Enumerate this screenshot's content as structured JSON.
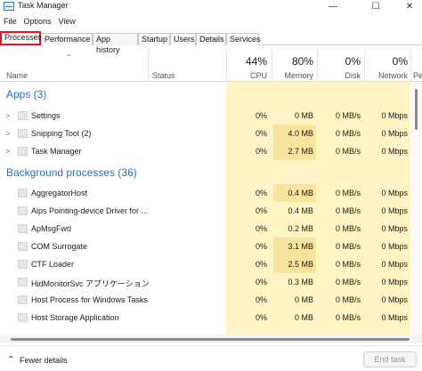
{
  "window": {
    "title": "Task Manager",
    "minimize_glyph": "—",
    "maximize_glyph": "☐",
    "close_glyph": "✕"
  },
  "menu": [
    "File",
    "Options",
    "View"
  ],
  "tabs": [
    "Processes",
    "Performance",
    "App history",
    "Startup",
    "Users",
    "Details",
    "Services"
  ],
  "active_tab": "Processes",
  "columns": {
    "name": "Name",
    "status": "Status",
    "cpu": {
      "pct": "44%",
      "label": "CPU"
    },
    "memory": {
      "pct": "80%",
      "label": "Memory"
    },
    "disk": {
      "pct": "0%",
      "label": "Disk"
    },
    "network": {
      "pct": "0%",
      "label": "Network"
    },
    "truncated_label": "Pe"
  },
  "sections": {
    "apps": "Apps (3)",
    "background": "Background processes (36)"
  },
  "apps": [
    {
      "name": "Settings",
      "cpu": "0%",
      "memory": "0 MB",
      "disk": "0 MB/s",
      "network": "0 Mbps"
    },
    {
      "name": "Snipping Tool (2)",
      "cpu": "0%",
      "memory": "4.0 MB",
      "disk": "0 MB/s",
      "network": "0 Mbps"
    },
    {
      "name": "Task Manager",
      "cpu": "0%",
      "memory": "2.7 MB",
      "disk": "0 MB/s",
      "network": "0 Mbps"
    }
  ],
  "background": [
    {
      "name": "AggregatorHost",
      "cpu": "0%",
      "memory": "0.4 MB",
      "disk": "0 MB/s",
      "network": "0 Mbps"
    },
    {
      "name": "Alps Pointing-device Driver for ...",
      "cpu": "0%",
      "memory": "0.4 MB",
      "disk": "0 MB/s",
      "network": "0 Mbps"
    },
    {
      "name": "ApMsgFwd",
      "cpu": "0%",
      "memory": "0.2 MB",
      "disk": "0 MB/s",
      "network": "0 Mbps"
    },
    {
      "name": "COM Surrogate",
      "cpu": "0%",
      "memory": "3.1 MB",
      "disk": "0 MB/s",
      "network": "0 Mbps"
    },
    {
      "name": "CTF Loader",
      "cpu": "0%",
      "memory": "2.5 MB",
      "disk": "0 MB/s",
      "network": "0 Mbps"
    },
    {
      "name": "HidMonitorSvc アプリケーション",
      "cpu": "0%",
      "memory": "0.3 MB",
      "disk": "0 MB/s",
      "network": "0 Mbps"
    },
    {
      "name": "Host Process for Windows Tasks",
      "cpu": "0%",
      "memory": "0 MB",
      "disk": "0 MB/s",
      "network": "0 Mbps"
    },
    {
      "name": "Host Storage Application",
      "cpu": "0%",
      "memory": "0 MB",
      "disk": "0 MB/s",
      "network": "0 Mbps"
    }
  ],
  "footer": {
    "fewer_details": "Fewer details",
    "end_task": "End task"
  },
  "colors": {
    "highlight": "#fff4c4",
    "highlight_strong": "#f9e49d",
    "section_title": "#2b6cb3",
    "active_tab_border": "#e81123"
  },
  "icons": {
    "app": "task-manager-icon",
    "expand": "chevron-right-icon",
    "sort": "sort-up-icon",
    "fewer": "chevron-up-icon"
  }
}
